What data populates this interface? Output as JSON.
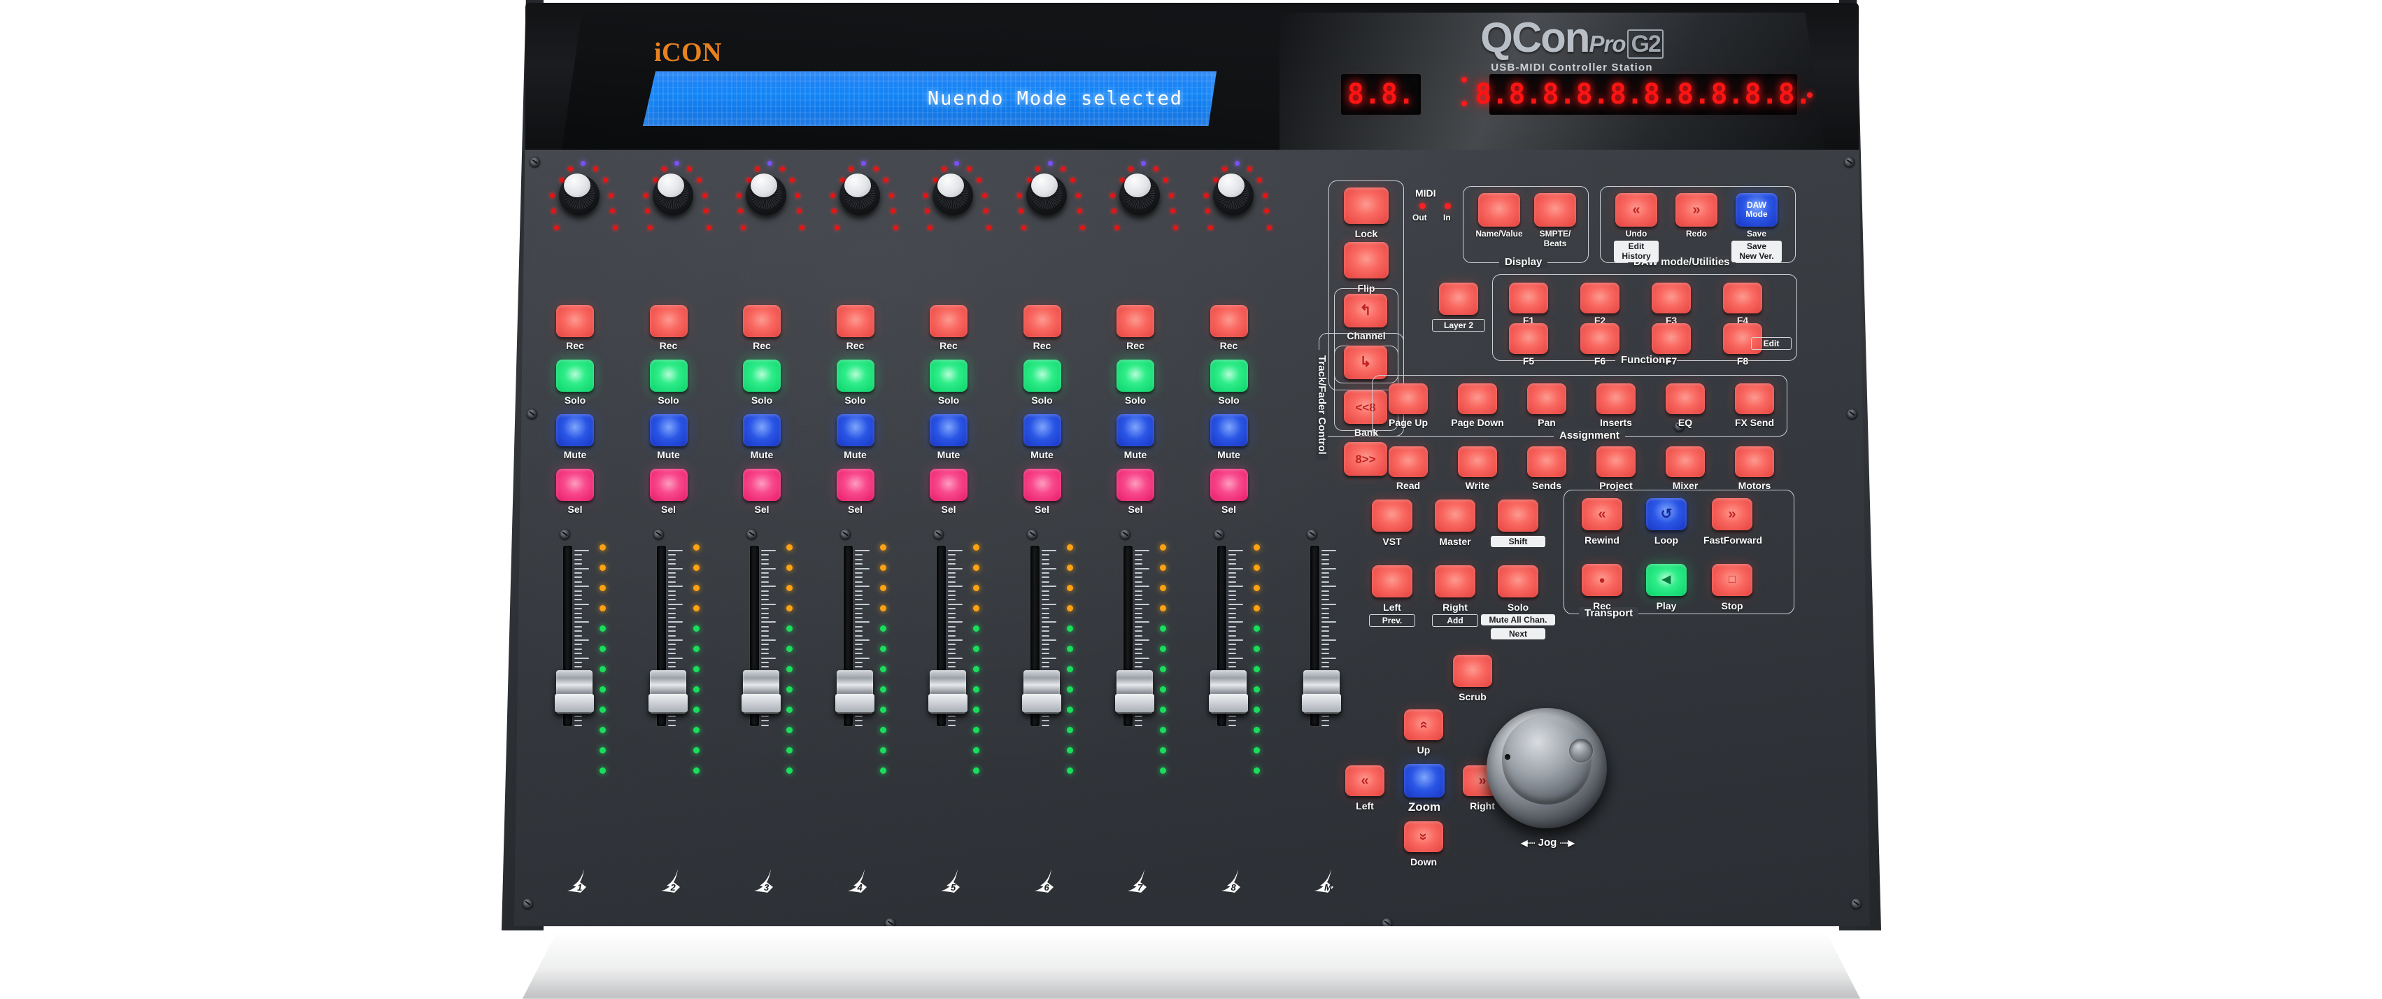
{
  "brand": {
    "manufacturer": "iCON",
    "model_main": "QCon",
    "model_pro": "Pro",
    "model_gen": "G2",
    "subtitle": "USB-MIDI Controller Station"
  },
  "lcd": {
    "text": "Nuendo Mode selected"
  },
  "led_display": {
    "small_digits": "8.8.",
    "big_digits": "8.8.8.8.8.8.8.8.8.8."
  },
  "midi": {
    "title": "MIDI",
    "out_label": "Out",
    "in_label": "In"
  },
  "channels": [
    {
      "number": "1",
      "rec": "Rec",
      "solo": "Solo",
      "mute": "Mute",
      "sel": "Sel"
    },
    {
      "number": "2",
      "rec": "Rec",
      "solo": "Solo",
      "mute": "Mute",
      "sel": "Sel"
    },
    {
      "number": "3",
      "rec": "Rec",
      "solo": "Solo",
      "mute": "Mute",
      "sel": "Sel"
    },
    {
      "number": "4",
      "rec": "Rec",
      "solo": "Solo",
      "mute": "Mute",
      "sel": "Sel"
    },
    {
      "number": "5",
      "rec": "Rec",
      "solo": "Solo",
      "mute": "Mute",
      "sel": "Sel"
    },
    {
      "number": "6",
      "rec": "Rec",
      "solo": "Solo",
      "mute": "Mute",
      "sel": "Sel"
    },
    {
      "number": "7",
      "rec": "Rec",
      "solo": "Solo",
      "mute": "Mute",
      "sel": "Sel"
    },
    {
      "number": "8",
      "rec": "Rec",
      "solo": "Solo",
      "mute": "Mute",
      "sel": "Sel"
    }
  ],
  "master_fader_mark": "M",
  "track_fader_control": {
    "group_label": "Track/Fader Control",
    "lock": "Lock",
    "flip": "Flip",
    "channel_label": "Channel",
    "channel_up_glyph": "↰",
    "channel_down_glyph": "↳",
    "bank_label": "Bank",
    "bank_prev": "<<8",
    "bank_next": "8>>"
  },
  "display_section": {
    "group_label": "Display",
    "name_value": "Name/Value",
    "smpte_beats": "SMPTE/\nBeats"
  },
  "daw_utilities": {
    "group_label": "DAW mode/Utilities",
    "undo": "Undo",
    "undo_sub": "Edit\nHistory",
    "undo_glyph": "«",
    "redo": "Redo",
    "redo_glyph": "»",
    "save": "Save",
    "save_glyph": "DAW\nMode",
    "save_sub": "Save\nNew Ver."
  },
  "functions": {
    "group_label": "Functions",
    "layer2": "Layer 2",
    "keys": [
      "F1",
      "F2",
      "F3",
      "F4",
      "F5",
      "F6",
      "F7",
      "F8"
    ],
    "f8_sub": "Edit"
  },
  "assignment": {
    "group_label": "Assignment",
    "row1": [
      "Page Up",
      "Page Down",
      "Pan",
      "Inserts",
      "EQ",
      "FX Send"
    ],
    "row2": [
      "Read",
      "Write",
      "Sends",
      "Project",
      "Mixer",
      "Motors"
    ]
  },
  "vst_section": {
    "vst": "VST",
    "master": "Master",
    "shift": "Shift",
    "left": "Left",
    "left_sub": "Prev.",
    "right": "Right",
    "right_sub": "Add",
    "solo": "Solo",
    "solo_sub1": "Mute All Chan.",
    "solo_sub2": "Next"
  },
  "transport": {
    "group_label": "Transport",
    "rewind": "Rewind",
    "rewind_glyph": "«",
    "loop": "Loop",
    "loop_glyph": "↺",
    "fastforward": "FastForward",
    "ff_glyph": "»",
    "rec": "Rec",
    "rec_glyph": "●",
    "play": "Play",
    "play_glyph": "◀",
    "stop": "Stop",
    "stop_glyph": "□"
  },
  "navigation": {
    "up": "Up",
    "up_glyph": "»",
    "down": "Down",
    "down_glyph": "»",
    "left": "Left",
    "left_glyph": "«",
    "right": "Right",
    "right_glyph": "»",
    "zoom": "Zoom",
    "scrub": "Scrub"
  },
  "jog": {
    "label": "Jog",
    "left_arrow": "◀····",
    "right_arrow": "····▶"
  },
  "colors": {
    "accent_orange": "#e8821f",
    "lcd_blue": "#1486f7",
    "led_red": "#ff1414",
    "btn_red": "#fc6a62",
    "btn_green": "#2ff08b",
    "btn_blue": "#2a56e8",
    "btn_pink": "#fb4a8d",
    "panel_gray": "#393d43"
  }
}
